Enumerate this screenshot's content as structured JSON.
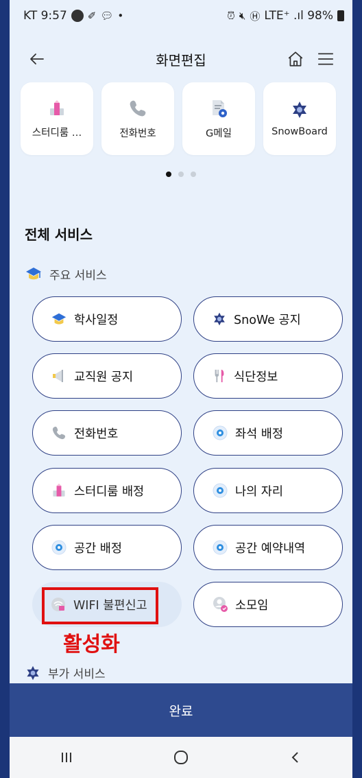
{
  "status_bar": {
    "time": "KT 9:57",
    "right_text": "LTE⁺ .ıl 98%"
  },
  "header": {
    "title": "화면편집"
  },
  "favorites": [
    {
      "label": "스터디룸 …",
      "icon": "studyroom-icon"
    },
    {
      "label": "전화번호",
      "icon": "phone-icon"
    },
    {
      "label": "G메일",
      "icon": "gmail-icon"
    },
    {
      "label": "SnowBoard",
      "icon": "snowflake-icon"
    }
  ],
  "pager": {
    "pages": 3,
    "active": 1
  },
  "all_services": {
    "title": "전체 서비스",
    "main_subhead": "주요 서비스",
    "main_items": [
      {
        "label": "학사일정",
        "icon": "graduation-cap-icon",
        "state": "active"
      },
      {
        "label": "SnoWe 공지",
        "icon": "snowflake-icon",
        "state": "active"
      },
      {
        "label": "교직원 공지",
        "icon": "megaphone-icon",
        "state": "active"
      },
      {
        "label": "식단정보",
        "icon": "cutlery-icon",
        "state": "active"
      },
      {
        "label": "전화번호",
        "icon": "phone-icon",
        "state": "active"
      },
      {
        "label": "좌석 배정",
        "icon": "target-icon",
        "state": "active"
      },
      {
        "label": "스터디룸 배정",
        "icon": "studyroom-icon",
        "state": "active"
      },
      {
        "label": "나의 자리",
        "icon": "target-icon",
        "state": "active"
      },
      {
        "label": "공간 배정",
        "icon": "target-icon",
        "state": "active"
      },
      {
        "label": "공간 예약내역",
        "icon": "target-icon",
        "state": "active"
      },
      {
        "label": "WIFI 불편신고",
        "icon": "wifi-report-icon",
        "state": "inactive"
      },
      {
        "label": "소모임",
        "icon": "club-icon",
        "state": "active"
      }
    ],
    "extra_subhead": "부가 서비스"
  },
  "annotation": {
    "text": "활성화"
  },
  "complete_button": {
    "label": "완료"
  },
  "colors": {
    "accent": "#2e4a8f",
    "pill_border": "#2d3f84",
    "highlight": "#e01010",
    "background": "#e9f1fb"
  }
}
